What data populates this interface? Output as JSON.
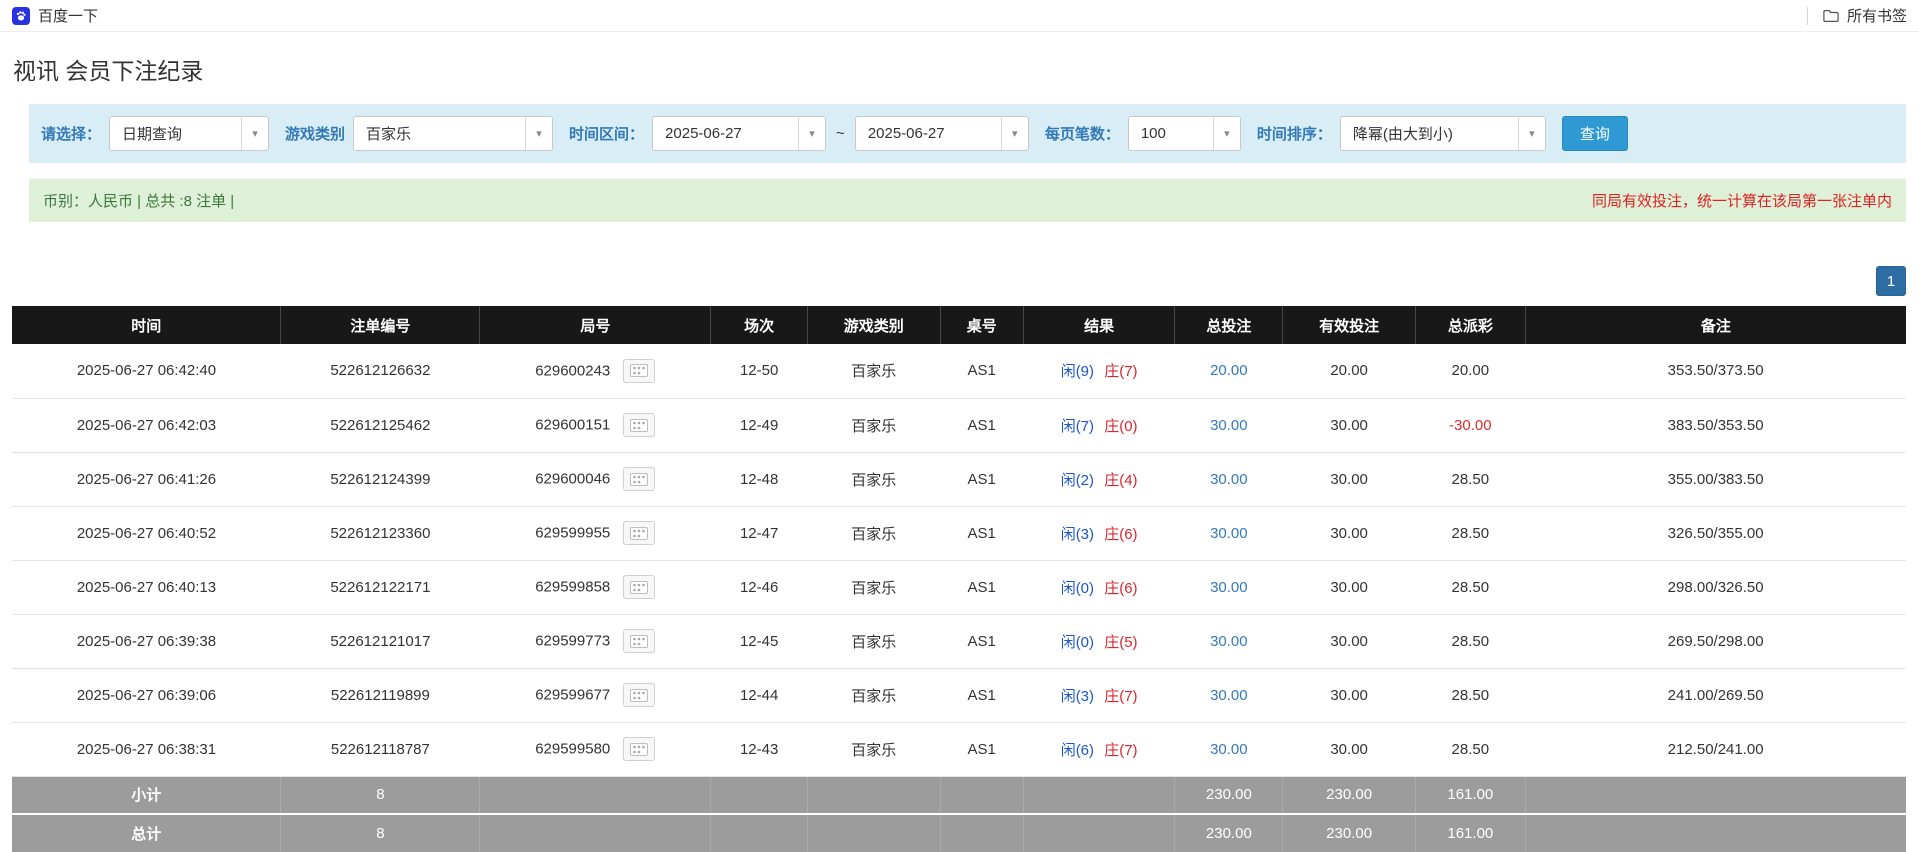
{
  "browser": {
    "bookmark_label": "百度一下",
    "all_bookmarks_label": "所有书签"
  },
  "page": {
    "title": "视讯 会员下注纪录"
  },
  "icons": {
    "chevron_down": "▾",
    "baidu_favicon": "paw-logo",
    "folder_icon": "folder-outline",
    "roadmap_icon": "road-grid"
  },
  "colors": {
    "filter_bg": "#d9edf7",
    "summary_bg": "#dff0d8",
    "label_blue": "#337ab7",
    "search_button_blue": "#2f99d3",
    "pagination_blue": "#2e6da4",
    "header_bg": "#181818",
    "footer_bg": "#9c9c9c",
    "player_blue": "#1e56cc",
    "banker_red": "#d9262c",
    "negative_red": "#e02b2b",
    "notice_red": "#dd2222"
  },
  "filters": {
    "select_label": "请选择：",
    "select_value": "日期查询",
    "game_type_label": "游戏类别",
    "game_type_value": "百家乐",
    "date_range_label": "时间区间：",
    "date_from": "2025-06-27",
    "date_separator": "~",
    "date_to": "2025-06-27",
    "page_size_label": "每页笔数：",
    "page_size_value": "100",
    "sort_label": "时间排序：",
    "sort_value": "降幂(由大到小)",
    "search_button": "查询"
  },
  "summary": {
    "currency_info": "币别：人民币 | 总共 :8 注单 |",
    "notice": "同局有效投注，统一计算在该局第一张注单内"
  },
  "pagination": {
    "current": "1"
  },
  "table": {
    "headers": [
      "时间",
      "注单编号",
      "局号",
      "场次",
      "游戏类别",
      "桌号",
      "结果",
      "总投注",
      "有效投注",
      "总派彩",
      "备注"
    ],
    "rows": [
      {
        "time": "2025-06-27 06:42:40",
        "bet_id": "522612126632",
        "round_id": "629600243",
        "session": "12-50",
        "game": "百家乐",
        "table_no": "AS1",
        "result_player": "闲(9)",
        "result_banker": "庄(7)",
        "total_bet": "20.00",
        "valid_bet": "20.00",
        "payout": "20.00",
        "note": "353.50/373.50"
      },
      {
        "time": "2025-06-27 06:42:03",
        "bet_id": "522612125462",
        "round_id": "629600151",
        "session": "12-49",
        "game": "百家乐",
        "table_no": "AS1",
        "result_player": "闲(7)",
        "result_banker": "庄(0)",
        "total_bet": "30.00",
        "valid_bet": "30.00",
        "payout": "-30.00",
        "note": "383.50/353.50"
      },
      {
        "time": "2025-06-27 06:41:26",
        "bet_id": "522612124399",
        "round_id": "629600046",
        "session": "12-48",
        "game": "百家乐",
        "table_no": "AS1",
        "result_player": "闲(2)",
        "result_banker": "庄(4)",
        "total_bet": "30.00",
        "valid_bet": "30.00",
        "payout": "28.50",
        "note": "355.00/383.50"
      },
      {
        "time": "2025-06-27 06:40:52",
        "bet_id": "522612123360",
        "round_id": "629599955",
        "session": "12-47",
        "game": "百家乐",
        "table_no": "AS1",
        "result_player": "闲(3)",
        "result_banker": "庄(6)",
        "total_bet": "30.00",
        "valid_bet": "30.00",
        "payout": "28.50",
        "note": "326.50/355.00"
      },
      {
        "time": "2025-06-27 06:40:13",
        "bet_id": "522612122171",
        "round_id": "629599858",
        "session": "12-46",
        "game": "百家乐",
        "table_no": "AS1",
        "result_player": "闲(0)",
        "result_banker": "庄(6)",
        "total_bet": "30.00",
        "valid_bet": "30.00",
        "payout": "28.50",
        "note": "298.00/326.50"
      },
      {
        "time": "2025-06-27 06:39:38",
        "bet_id": "522612121017",
        "round_id": "629599773",
        "session": "12-45",
        "game": "百家乐",
        "table_no": "AS1",
        "result_player": "闲(0)",
        "result_banker": "庄(5)",
        "total_bet": "30.00",
        "valid_bet": "30.00",
        "payout": "28.50",
        "note": "269.50/298.00"
      },
      {
        "time": "2025-06-27 06:39:06",
        "bet_id": "522612119899",
        "round_id": "629599677",
        "session": "12-44",
        "game": "百家乐",
        "table_no": "AS1",
        "result_player": "闲(3)",
        "result_banker": "庄(7)",
        "total_bet": "30.00",
        "valid_bet": "30.00",
        "payout": "28.50",
        "note": "241.00/269.50"
      },
      {
        "time": "2025-06-27 06:38:31",
        "bet_id": "522612118787",
        "round_id": "629599580",
        "session": "12-43",
        "game": "百家乐",
        "table_no": "AS1",
        "result_player": "闲(6)",
        "result_banker": "庄(7)",
        "total_bet": "30.00",
        "valid_bet": "30.00",
        "payout": "28.50",
        "note": "212.50/241.00"
      }
    ],
    "subtotal": {
      "label": "小计",
      "count": "8",
      "total_bet": "230.00",
      "valid_bet": "230.00",
      "payout": "161.00"
    },
    "total": {
      "label": "总计",
      "count": "8",
      "total_bet": "230.00",
      "valid_bet": "230.00",
      "payout": "161.00"
    }
  }
}
